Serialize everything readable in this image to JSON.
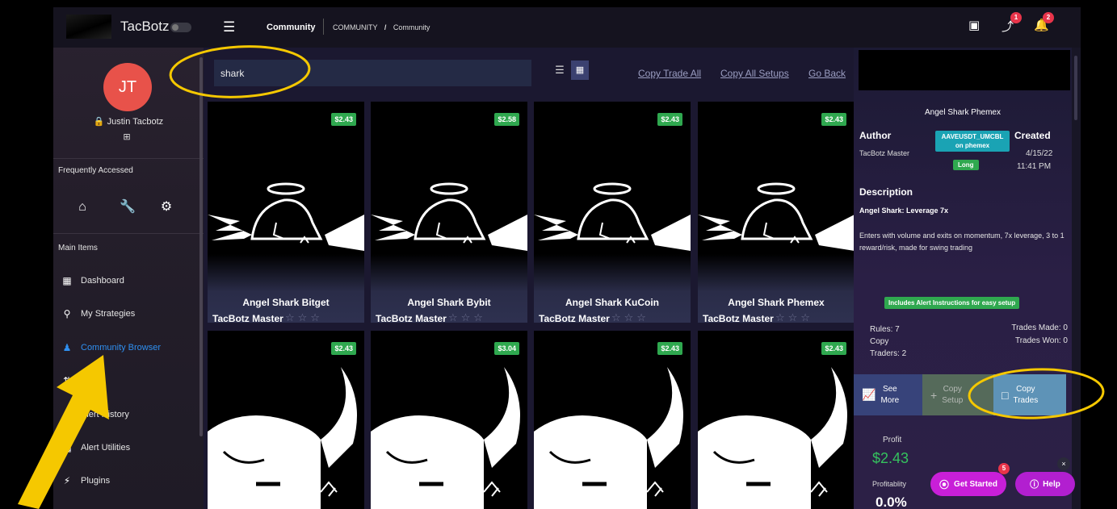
{
  "brand": {
    "name": "TacBotz"
  },
  "user": {
    "initials": "JT",
    "name": "Justin Tacbotz",
    "login_icon": "login-icon"
  },
  "sidebar": {
    "frequently_accessed_label": "Frequently Accessed",
    "frequent_icons": [
      "home-icon",
      "wrench-icon",
      "gear-icon"
    ],
    "main_items_label": "Main Items",
    "items": [
      {
        "label": "Dashboard",
        "icon": "dashboard-icon",
        "active": false
      },
      {
        "label": "My Strategies",
        "icon": "lightbulb-icon",
        "active": false
      },
      {
        "label": "Community Browser",
        "icon": "people-icon",
        "active": true
      },
      {
        "label": "",
        "icon": "sort-icon",
        "active": false
      },
      {
        "label": "Alert History",
        "icon": "history-icon",
        "active": false
      },
      {
        "label": "Alert Utilities",
        "icon": "grid-icon",
        "active": false
      },
      {
        "label": "Plugins",
        "icon": "plug-icon",
        "active": false
      }
    ]
  },
  "topbar": {
    "title": "Community",
    "breadcrumb_root": "COMMUNITY",
    "breadcrumb_separator": "/",
    "breadcrumb_current": "Community",
    "wallet_icon": "wallet-icon",
    "trades_badge": "1",
    "notifications_badge": "2"
  },
  "search": {
    "value": "shark"
  },
  "links": {
    "copy_trade_all": "Copy Trade All",
    "copy_all_setups": "Copy All Setups",
    "go_back": "Go Back"
  },
  "cards_row1": [
    {
      "name": "Angel Shark Bitget",
      "author": "TacBotz Master",
      "price": "$2.43"
    },
    {
      "name": "Angel Shark Bybit",
      "author": "TacBotz Master",
      "price": "$2.58"
    },
    {
      "name": "Angel Shark KuCoin",
      "author": "TacBotz Master",
      "price": "$2.43"
    },
    {
      "name": "Angel Shark Phemex",
      "author": "TacBotz Master",
      "price": "$2.43"
    }
  ],
  "cards_row2": [
    {
      "price": "$2.43"
    },
    {
      "price": "$3.04"
    },
    {
      "price": "$2.43"
    },
    {
      "price": "$2.43"
    }
  ],
  "panel": {
    "title": "Angel Shark Phemex",
    "author_label": "Author",
    "author_value": "TacBotz Master",
    "pair_line1": "AAVEUSDT_UMCBL",
    "pair_line2": "on phemex",
    "direction": "Long",
    "created_label": "Created",
    "created_date": "4/15/22",
    "created_time": "11:41 PM",
    "description_label": "Description",
    "description_title": "Angel Shark: Leverage 7x",
    "description_body": "Enters with volume and exits on momentum, 7x leverage, 3 to 1 reward/risk, made for swing trading",
    "alert_badge": "Includes Alert Instructions for easy setup",
    "rules": "Rules: 7",
    "copy_traders_1": "Copy",
    "copy_traders_2": "Traders: 2",
    "trades_made": "Trades Made: 0",
    "trades_won": "Trades Won: 0",
    "see_more_1": "See",
    "see_more_2": "More",
    "copy_setup_1": "Copy",
    "copy_setup_2": "Setup",
    "copy_trades_1": "Copy",
    "copy_trades_2": "Trades",
    "profit_label": "Profit",
    "profit_value": "$2.43",
    "profitability_label": "Profitablity",
    "profitability_value": "0.0%"
  },
  "floating": {
    "get_started": "Get Started",
    "get_started_badge": "5",
    "help": "Help",
    "close": "×"
  },
  "colors": {
    "accent_blue": "#2f8ff0",
    "price_green": "#2fa84f",
    "badge_red": "#e8344a",
    "cta_purple": "#c81fd8",
    "annotation_yellow": "#f5c800"
  }
}
